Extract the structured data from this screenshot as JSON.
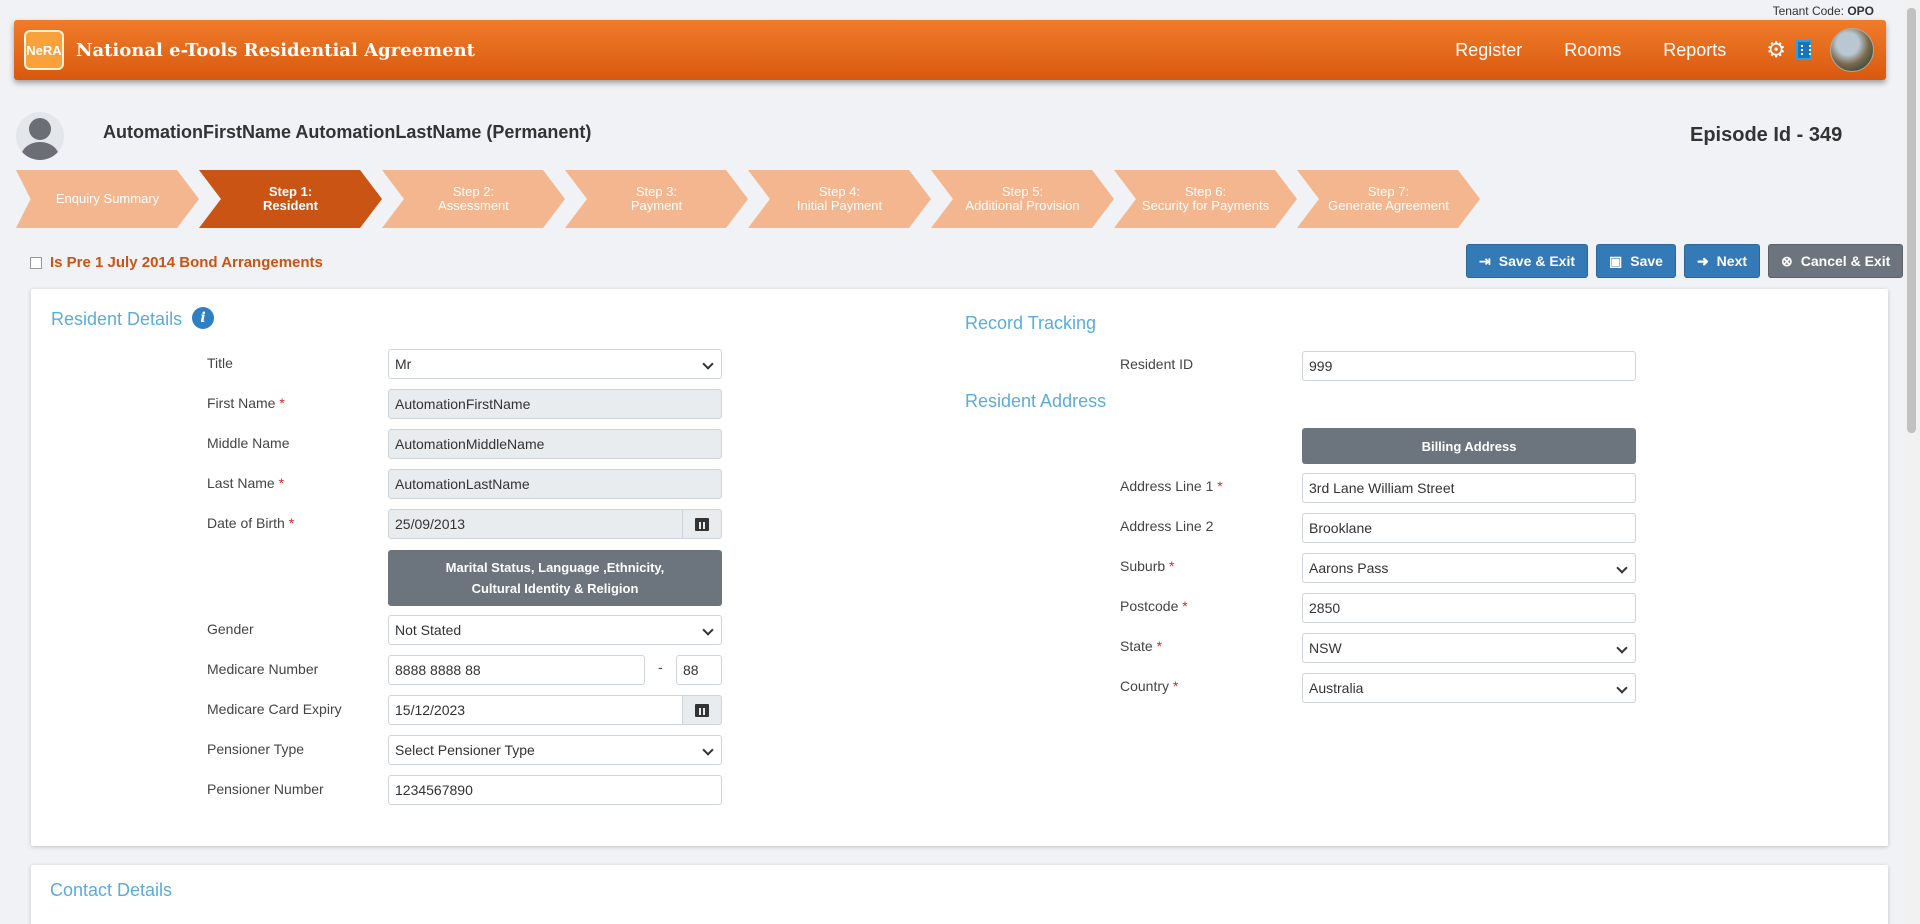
{
  "tenant": {
    "label": "Tenant Code:",
    "code": "OPO"
  },
  "header": {
    "logo_text": "NeRA",
    "title": "National e-Tools Residential Agreement",
    "nav": [
      "Register",
      "Rooms",
      "Reports"
    ]
  },
  "resident": {
    "name": "AutomationFirstName AutomationLastName (Permanent)",
    "episode": "Episode Id - 349"
  },
  "steps": [
    {
      "line1": "Enquiry Summary",
      "line2": ""
    },
    {
      "line1": "Step 1:",
      "line2": "Resident"
    },
    {
      "line1": "Step 2:",
      "line2": "Assessment"
    },
    {
      "line1": "Step 3:",
      "line2": "Payment"
    },
    {
      "line1": "Step 4:",
      "line2": "Initial Payment"
    },
    {
      "line1": "Step 5:",
      "line2": "Additional Provision"
    },
    {
      "line1": "Step 6:",
      "line2": "Security for Payments"
    },
    {
      "line1": "Step 7:",
      "line2": "Generate Agreement"
    }
  ],
  "bond_label": "Is Pre 1 July 2014 Bond Arrangements",
  "actions": {
    "save_exit": "Save & Exit",
    "save": "Save",
    "next": "Next",
    "cancel_exit": "Cancel & Exit"
  },
  "resident_details": {
    "title": "Resident Details",
    "title_label": "Title",
    "title_value": "Mr",
    "first_name_label": "First Name",
    "first_name": "AutomationFirstName",
    "middle_name_label": "Middle Name",
    "middle_name": "AutomationMiddleName",
    "last_name_label": "Last Name",
    "last_name": "AutomationLastName",
    "dob_label": "Date of Birth",
    "dob": "25/09/2013",
    "marital_btn_line1": "Marital Status, Language ,Ethnicity,",
    "marital_btn_line2": "Cultural Identity & Religion",
    "gender_label": "Gender",
    "gender": "Not Stated",
    "medicare_label": "Medicare Number",
    "medicare": "8888 8888 88",
    "medicare_dash": "-",
    "medicare_irn": "88",
    "medicare_expiry_label": "Medicare Card Expiry",
    "medicare_expiry": "15/12/2023",
    "pensioner_type_label": "Pensioner Type",
    "pensioner_type": "Select Pensioner Type",
    "pensioner_number_label": "Pensioner Number",
    "pensioner_number": "1234567890"
  },
  "record_tracking": {
    "title": "Record Tracking",
    "resident_id_label": "Resident ID",
    "resident_id": "999"
  },
  "address": {
    "title": "Resident Address",
    "billing_btn": "Billing Address",
    "line1_label": "Address Line 1",
    "line1": "3rd Lane William Street",
    "line2_label": "Address Line 2",
    "line2": "Brooklane",
    "suburb_label": "Suburb",
    "suburb": "Aarons Pass",
    "postcode_label": "Postcode",
    "postcode": "2850",
    "state_label": "State",
    "state": "NSW",
    "country_label": "Country",
    "country": "Australia"
  },
  "contact": {
    "title": "Contact Details"
  },
  "required_marker": "*",
  "colors": {
    "brand_orange": "#e8701f",
    "active_step": "#c95414",
    "link_blue": "#5bacd8",
    "button_blue": "#337ab7"
  }
}
